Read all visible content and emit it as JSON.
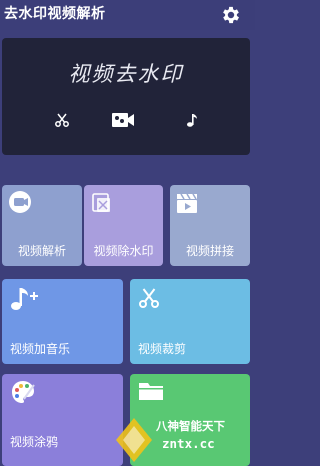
{
  "app": {
    "title": "去水印视频解析"
  },
  "banner": {
    "title": "视频去水印",
    "icons": [
      "scissors-icon",
      "video-camera-icon",
      "music-note-icon"
    ]
  },
  "tiles": [
    {
      "label": "视频解析",
      "icon": "video-parse-icon",
      "color": "#8ea0cf"
    },
    {
      "label": "视频除水印",
      "icon": "remove-watermark-icon",
      "color": "#a99edd"
    },
    {
      "label": "视频拼接",
      "icon": "clapperboard-icon",
      "color": "#99a9cf"
    },
    {
      "label": "视频加音乐",
      "icon": "add-music-icon",
      "color": "#6f97e6"
    },
    {
      "label": "视频裁剪",
      "icon": "scissors-icon",
      "color": "#6cbde4"
    },
    {
      "label": "视频涂鸦",
      "icon": "palette-icon",
      "color": "#8b7fda"
    },
    {
      "label": "",
      "icon": "folder-icon",
      "color": "#59c873"
    }
  ],
  "watermark": {
    "line1": "八神智能天下",
    "line2": "zntx.cc"
  }
}
